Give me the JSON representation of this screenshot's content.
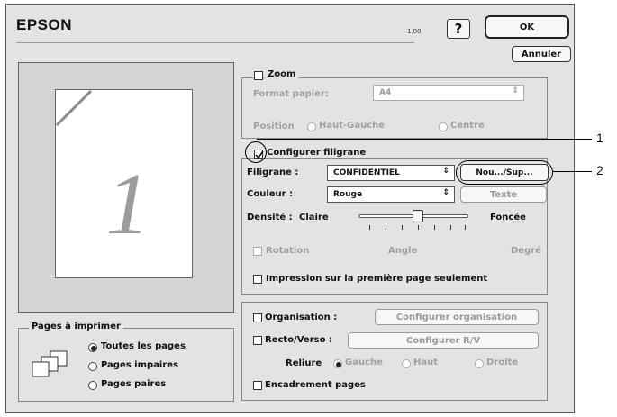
{
  "header": {
    "brand": "EPSON",
    "version": "1.00",
    "help_label": "?",
    "ok_label": "OK",
    "cancel_label": "Annuler"
  },
  "preview": {
    "page_number": "1"
  },
  "zoom": {
    "label": "Zoom",
    "paper_format_label": "Format papier:",
    "paper_format_value": "A4",
    "position_label": "Position",
    "position_options": [
      "Haut-Gauche",
      "Centre"
    ]
  },
  "watermark": {
    "configure_label": "Configurer filigrane",
    "filigrane_label": "Filigrane :",
    "filigrane_value": "CONFIDENTIEL",
    "new_del_label": "Nou.../Sup...",
    "couleur_label": "Couleur :",
    "couleur_value": "Rouge",
    "texte_label": "Texte",
    "densite_label": "Densité :",
    "claire_label": "Claire",
    "foncee_label": "Foncée",
    "density_level_fraction": 0.5,
    "rotation_label": "Rotation",
    "angle_label": "Angle",
    "degre_label": "Degré",
    "first_page_label": "Impression sur la première page seulement"
  },
  "layout": {
    "organisation_label": "Organisation :",
    "configure_org_label": "Configurer organisation",
    "duplex_label": "Recto/Verso :",
    "configure_duplex_label": "Configurer R/V",
    "reliure_label": "Reliure",
    "reliure_options": [
      "Gauche",
      "Haut",
      "Droite"
    ],
    "border_label": "Encadrement pages"
  },
  "pages": {
    "title": "Pages à imprimer",
    "options": [
      "Toutes les pages",
      "Pages impaires",
      "Pages paires"
    ],
    "selected_index": 0
  },
  "callouts": {
    "one": "1",
    "two": "2"
  }
}
